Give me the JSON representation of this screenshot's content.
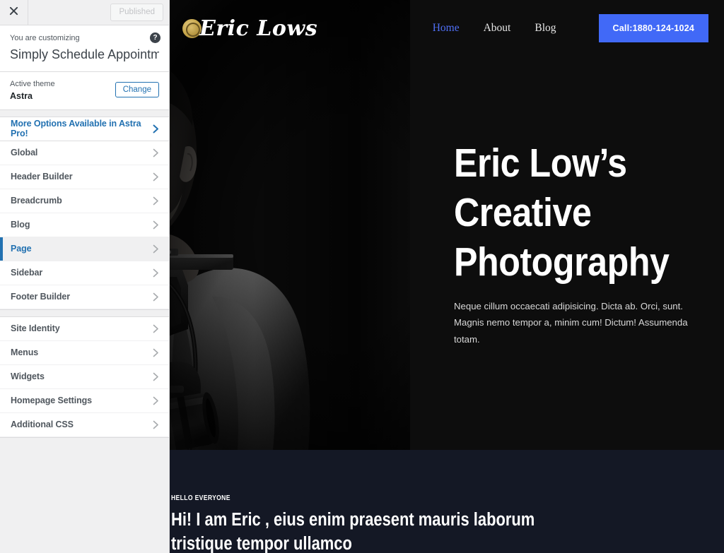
{
  "customizer": {
    "close_icon": "close-icon",
    "publish_label": "Published",
    "kicker": "You are customizing",
    "title": "Simply Schedule Appointment…",
    "help_icon": "?",
    "theme_kicker": "Active theme",
    "theme_name": "Astra",
    "change_label": "Change",
    "pro_item": {
      "label": "More Options Available in Astra Pro!"
    },
    "items_primary": [
      {
        "label": "Global",
        "active": false
      },
      {
        "label": "Header Builder",
        "active": false
      },
      {
        "label": "Breadcrumb",
        "active": false
      },
      {
        "label": "Blog",
        "active": false
      },
      {
        "label": "Page",
        "active": true
      },
      {
        "label": "Sidebar",
        "active": false
      },
      {
        "label": "Footer Builder",
        "active": false
      }
    ],
    "items_secondary": [
      {
        "label": "Site Identity"
      },
      {
        "label": "Menus"
      },
      {
        "label": "Widgets"
      },
      {
        "label": "Homepage Settings"
      },
      {
        "label": "Additional CSS"
      }
    ],
    "colors": {
      "accent": "#2271b1",
      "panel_bg": "#f0f0f1",
      "list_bg": "#ffffff",
      "border": "#dcdcde",
      "text": "#50575e"
    }
  },
  "preview": {
    "site_header": {
      "brand_name": "Eric Lows",
      "brand_mark_icon": "camera-lens-icon",
      "nav": [
        {
          "label": "Home",
          "active": true
        },
        {
          "label": "About",
          "active": false
        },
        {
          "label": "Blog",
          "active": false
        }
      ],
      "call_button": "Call:1880-124-1024",
      "call_button_color": "#4169f7"
    },
    "hero": {
      "title": "Eric Low’s\nCreative\nPhotography",
      "subtitle": "Neque cillum occaecati adipisicing. Dicta ab. Orci, sunt. Magnis nemo tempor a, minim cum! Dictum! Assumenda totam.",
      "background_color": "#0d0d0d",
      "photo_alt": "black-and-white photo of bearded photographer holding a camera"
    },
    "about": {
      "kicker": "HELLO EVERYONE",
      "title": "Hi! I am Eric , eius enim praesent mauris laborum\ntristique tempor ullamco",
      "background_color": "#141825"
    }
  }
}
